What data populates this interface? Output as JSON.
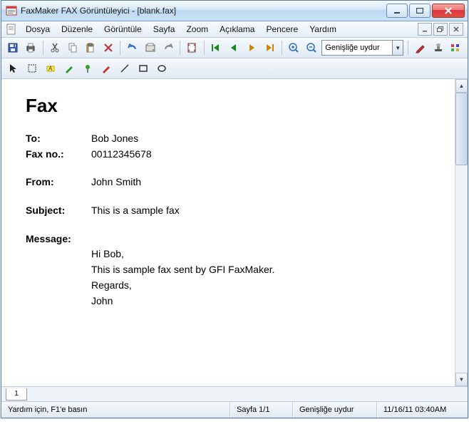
{
  "window": {
    "title": "FaxMaker FAX Görüntüleyici - [blank.fax]"
  },
  "menubar": {
    "items": [
      "Dosya",
      "Düzenle",
      "Görüntüle",
      "Sayfa",
      "Zoom",
      "Açıklama",
      "Pencere",
      "Yardım"
    ]
  },
  "toolbar_main": {
    "zoom_value": "Genişliğe uydur"
  },
  "page_tabs": {
    "current": "1"
  },
  "document": {
    "heading": "Fax",
    "to_label": "To:",
    "to_value": "Bob Jones",
    "faxno_label": "Fax no.:",
    "faxno_value": "00112345678",
    "from_label": "From:",
    "from_value": "John Smith",
    "subject_label": "Subject:",
    "subject_value": "This is a sample fax",
    "message_label": "Message:",
    "message_lines": [
      "Hi Bob,",
      "This is sample fax sent by GFI FaxMaker.",
      "Regards,",
      "John"
    ]
  },
  "statusbar": {
    "help": "Yardım için, F1'e basın",
    "page": "Sayfa 1/1",
    "zoom": "Genişliğe uydur",
    "datetime": "11/16/11 03:40AM"
  }
}
